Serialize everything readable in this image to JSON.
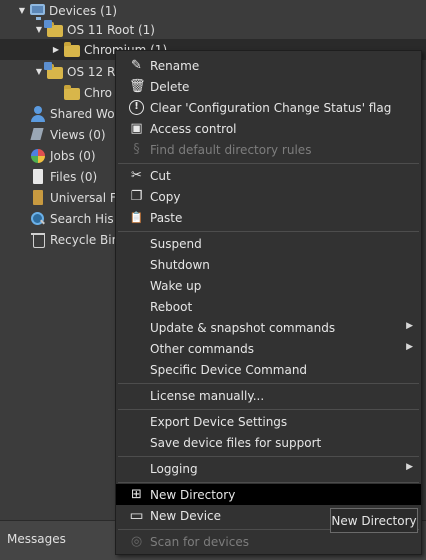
{
  "tree": {
    "items": [
      {
        "label": "Devices (1)",
        "arrow": "▼",
        "icon": "monitor-icon"
      },
      {
        "label": "OS 11 Root (1)",
        "arrow": "▼",
        "icon": "folder-icon"
      },
      {
        "label": "Chromium (1)",
        "arrow": "▶",
        "icon": "folder-icon"
      },
      {
        "label": "OS 12 R",
        "arrow": "▼",
        "icon": "folder-icon"
      },
      {
        "label": "Chro",
        "arrow": "",
        "icon": "folder-icon"
      },
      {
        "label": "Shared Wo",
        "arrow": "",
        "icon": "user-icon"
      },
      {
        "label": "Views (0)",
        "arrow": "",
        "icon": "views-icon"
      },
      {
        "label": "Jobs (0)",
        "arrow": "",
        "icon": "jobs-icon"
      },
      {
        "label": "Files (0)",
        "arrow": "",
        "icon": "file-icon"
      },
      {
        "label": "Universal F",
        "arrow": "",
        "icon": "book-icon"
      },
      {
        "label": "Search His",
        "arrow": "",
        "icon": "search-icon"
      },
      {
        "label": "Recycle Bin",
        "arrow": "",
        "icon": "recycle-bin-icon"
      }
    ]
  },
  "bottom": {
    "messages": "Messages"
  },
  "menu": {
    "items": [
      {
        "label": "Rename",
        "icon": "✎",
        "icon_name": "pencil-icon",
        "disabled": false
      },
      {
        "label": "Delete",
        "icon": "🗑",
        "icon_name": "trash-icon",
        "disabled": false
      },
      {
        "label": "Clear 'Configuration Change Status' flag",
        "icon": "!",
        "icon_name": "exclamation-icon",
        "disabled": false
      },
      {
        "label": "Access control",
        "icon": "▣",
        "icon_name": "id-card-icon",
        "disabled": false
      },
      {
        "label": "Find default directory rules",
        "icon": "§",
        "icon_name": "section-icon",
        "disabled": true
      },
      {
        "label": "Cut",
        "icon": "✂",
        "icon_name": "scissors-icon",
        "disabled": false
      },
      {
        "label": "Copy",
        "icon": "❐",
        "icon_name": "copy-icon",
        "disabled": false
      },
      {
        "label": "Paste",
        "icon": "📋",
        "icon_name": "clipboard-icon",
        "disabled": false
      },
      {
        "label": "Suspend",
        "disabled": false
      },
      {
        "label": "Shutdown",
        "disabled": false
      },
      {
        "label": "Wake up",
        "disabled": false
      },
      {
        "label": "Reboot",
        "disabled": false
      },
      {
        "label": "Update & snapshot commands",
        "disabled": false,
        "submenu": true
      },
      {
        "label": "Other commands",
        "disabled": false,
        "submenu": true
      },
      {
        "label": "Specific Device Command",
        "disabled": false
      },
      {
        "label": "License manually...",
        "disabled": false
      },
      {
        "label": "Export Device Settings",
        "disabled": false
      },
      {
        "label": "Save device files for support",
        "disabled": false
      },
      {
        "label": "Logging",
        "disabled": false,
        "submenu": true
      },
      {
        "label": "New Directory",
        "icon": "⊞",
        "icon_name": "new-folder-icon",
        "disabled": false,
        "highlighted": true
      },
      {
        "label": "New Device",
        "icon": "▭",
        "icon_name": "monitor-icon",
        "disabled": false
      },
      {
        "label": "Scan for devices",
        "icon": "◎",
        "icon_name": "scan-icon",
        "disabled": true
      }
    ],
    "submenu_arrow": "▶"
  },
  "tooltip": {
    "text": "New Directory"
  },
  "colors": {
    "background": "#3c3c3c",
    "menu_background": "#323232",
    "highlight": "#000000",
    "disabled_text": "#7d7d7d"
  }
}
